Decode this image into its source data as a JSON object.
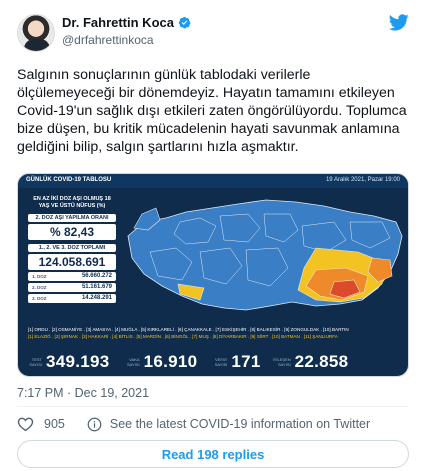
{
  "author": {
    "name": "Dr. Fahrettin Koca",
    "handle": "@drfahrettinkoca"
  },
  "tweet": {
    "text": "Salgının sonuçlarının günlük tablodaki verilerle ölçülemeyeceği bir dönemdeyiz. Hayatın tamamını etkileyen Covid-19'un sağlık dışı etkileri zaten öngörülüyordu. Toplumca bize düşen, bu kritik mücadelenin hayati savunmak anlamına geldiğini bilip, salgın şartlarını hızla aşmaktır.",
    "timestamp": "7:17 PM · Dec 19, 2021",
    "likes": "905",
    "covid_info": "See the latest COVID-19 information on Twitter",
    "read_replies": "Read 198 replies"
  },
  "media": {
    "title": "GÜNLÜK COVID-19 TABLOSU",
    "date": "19 Aralık 2021, Pazar 19:00",
    "panel_head": "EN AZ İKİ DOZ AŞI OLMUŞ 18 YAŞ VE ÜSTÜ NÜFUS (%)",
    "rate_label": "2. DOZ AŞI YAPILMA ORANI",
    "rate_value": "% 82,43",
    "total_label": "1., 2. VE 3. DOZ TOPLAMI",
    "total_value": "124.058.691",
    "doses": [
      {
        "label": "1. DOZ",
        "value": "56.660.272"
      },
      {
        "label": "2. DOZ",
        "value": "51.161.679"
      },
      {
        "label": "3. DOZ",
        "value": "14.248.291"
      }
    ],
    "legend_white": "[1] ORDU . [2] OSMANİYE . [3] AMASYA . [4] MUĞLA . [5] KIRKLARELİ . [6] ÇANAKKALE . [7] ESKİŞEHİR . [8] BALIKESİR . [9] ZONGULDAK . [10] BARTIN",
    "legend_yellow": "[1] ELAZIĞ . [2] ŞIRNAK . [3] HAKKARİ . [4] BİTLİS . [5] MARDİN . [6] BİNGÖL . [7] MUŞ . [8] DİYARBAKIR . [9] SİİRT . [10] BATMAN . [11] ŞANLIURFA",
    "stats": [
      {
        "label": "TEST SAYISI",
        "value": "349.193"
      },
      {
        "label": "VAKA SAYISI",
        "value": "16.910"
      },
      {
        "label": "VEFAT SAYISI",
        "value": "171"
      },
      {
        "label": "İYİLEŞEN SAYISI",
        "value": "22.858"
      }
    ]
  },
  "colors": {
    "text": "#0f1419",
    "muted": "#536471",
    "accent": "#1d9bf0",
    "map_blue": "#3a7fc6",
    "map_yellow": "#f3c323",
    "map_orange": "#ee8a2a",
    "map_red": "#d94b2b"
  },
  "icons": [
    "verified-badge-icon",
    "twitter-bird-icon",
    "heart-icon",
    "info-icon"
  ]
}
